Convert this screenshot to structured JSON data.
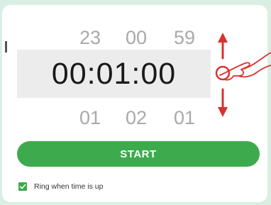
{
  "timer": {
    "above": {
      "hours": "23",
      "minutes": "00",
      "seconds": "59"
    },
    "current": "00:01:00",
    "below": {
      "hours": "01",
      "minutes": "02",
      "seconds": "01"
    }
  },
  "actions": {
    "start_label": "START"
  },
  "options": {
    "ring_label": "Ring when time is up",
    "ring_checked": true
  },
  "colors": {
    "accent": "#3daa4d",
    "gesture": "#d8322e",
    "highlight": "#ececec",
    "background": "#d9efe4"
  },
  "icons": {
    "gesture": "swipe-up-down-hand-icon",
    "check": "check-icon"
  }
}
